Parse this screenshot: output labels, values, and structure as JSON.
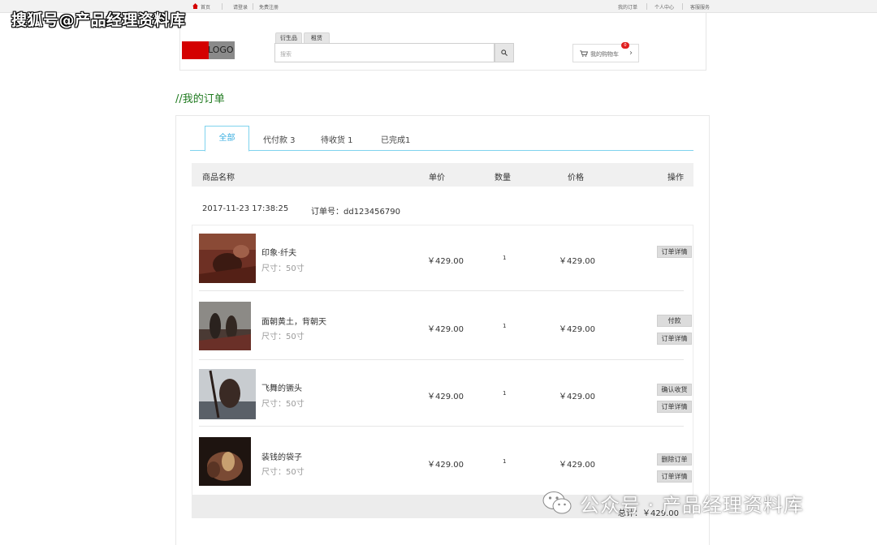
{
  "watermark_top": "搜狐号@产品经理资料库",
  "watermark_bottom": "公众号 · 产品经理资料库",
  "topbar": {
    "home": "首页",
    "login": "请登录",
    "register": "免费注册",
    "my_orders": "我的订单",
    "user_center": "个人中心",
    "customer_service": "客服服务"
  },
  "header": {
    "logo_text": "LOGO",
    "search_tabs": [
      "衍生品",
      "租赁"
    ],
    "search_placeholder": "搜索",
    "cart_label": "我的购物车",
    "cart_count": "0"
  },
  "page_title": "//我的订单",
  "order_tabs": [
    {
      "label": "全部",
      "active": true
    },
    {
      "label": "代付款 3",
      "active": false
    },
    {
      "label": "待收货 1",
      "active": false
    },
    {
      "label": "已完成1",
      "active": false
    }
  ],
  "table_headers": [
    "商品名称",
    "单价",
    "数量",
    "价格",
    "操作"
  ],
  "order": {
    "datetime": "2017-11-23 17:38:25",
    "order_no": "订单号：dd123456790"
  },
  "items": [
    {
      "name": "印象·纤夫",
      "size": "尺寸：50寸",
      "unit_price": "￥429.00",
      "qty": "1",
      "price": "￥429.00",
      "actions": [
        "订单详情"
      ]
    },
    {
      "name": "面朝黄土，背朝天",
      "size": "尺寸：50寸",
      "unit_price": "￥429.00",
      "qty": "1",
      "price": "￥429.00",
      "actions": [
        "付款",
        "订单详情"
      ]
    },
    {
      "name": "飞舞的镢头",
      "size": "尺寸：50寸",
      "unit_price": "￥429.00",
      "qty": "1",
      "price": "￥429.00",
      "actions": [
        "确认收货",
        "订单详情"
      ]
    },
    {
      "name": "装钱的袋子",
      "size": "尺寸：50寸",
      "unit_price": "￥429.00",
      "qty": "1",
      "price": "￥429.00",
      "actions": [
        "删除订单",
        "订单详情"
      ]
    }
  ],
  "total": "总计：￥429.00",
  "colors": {
    "accent_tab": "#3aaee0",
    "title_green": "#1f7a1f",
    "logo_red": "#d40000",
    "badge_red": "#e02020"
  },
  "icons": [
    "home-icon",
    "search-icon",
    "cart-icon",
    "chevron-right-icon",
    "wechat-icon"
  ]
}
